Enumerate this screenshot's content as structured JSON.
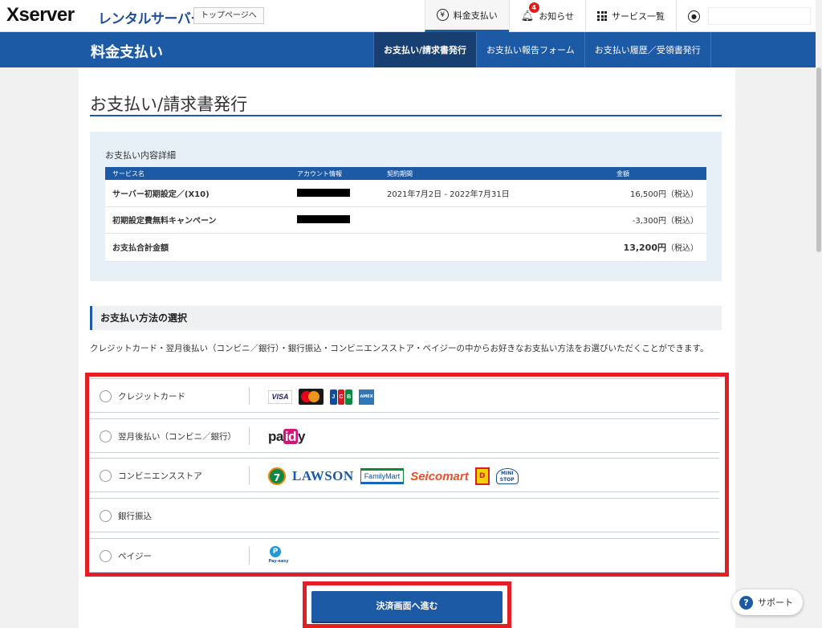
{
  "header": {
    "logo": "Xserver",
    "logo_sub": "レンタルサーバー",
    "toppage_label": "トップページへ",
    "nav": [
      {
        "label": "料金支払い",
        "icon": "yen-circle-icon"
      },
      {
        "label": "お知らせ",
        "icon": "bell-icon",
        "badge": "4"
      },
      {
        "label": "サービス一覧",
        "icon": "grid-icon"
      },
      {
        "label": "",
        "icon": "user-icon"
      }
    ]
  },
  "bluebar": {
    "title": "料金支払い",
    "tabs": [
      {
        "label": "お支払い/請求書発行",
        "active": true
      },
      {
        "label": "お支払い報告フォーム",
        "active": false
      },
      {
        "label": "お支払い履歴／受領書発行",
        "active": false
      }
    ]
  },
  "page": {
    "title": "お支払い/請求書発行"
  },
  "details": {
    "label": "お支払い内容詳細",
    "columns": [
      "サービス名",
      "アカウント情報",
      "契約期間",
      "金額"
    ],
    "rows": [
      {
        "service": "サーバー初期設定／(X10)",
        "period": "2021年7月2日 - 2022年7月31日",
        "amount": "16,500円（税込）"
      },
      {
        "service": "初期設定費無料キャンペーン",
        "period": "",
        "amount": "-3,300円（税込）"
      }
    ],
    "total_label": "お支払合計金額",
    "total_amount": "13,200円",
    "total_tax": "（税込）"
  },
  "payment": {
    "section_title": "お支払い方法の選択",
    "description": "クレジットカード・翌月後払い（コンビニ／銀行）・銀行振込・コンビニエンスストア・ペイジーの中からお好きなお支払い方法をお選びいただくことができます。",
    "options": [
      {
        "label": "クレジットカード"
      },
      {
        "label": "翌月後払い（コンビニ／銀行）"
      },
      {
        "label": "コンビニエンスストア"
      },
      {
        "label": "銀行振込"
      },
      {
        "label": "ペイジー"
      }
    ],
    "logos": {
      "visa": "VISA",
      "jcb": [
        "J",
        "C",
        "B"
      ],
      "amex": "AMEX",
      "paidy_pa": "pa",
      "paidy_id": "id",
      "paidy_y": "y",
      "seven": "7",
      "lawson": "LAWSON",
      "famima": "FamilyMart",
      "seico": "Seicomart",
      "daily": "D",
      "ministop": "MINI STOP",
      "payeasy_p": "P",
      "payeasy_t": "Pay-easy"
    },
    "proceed_label": "決済画面へ進む"
  },
  "support": {
    "label": "サポート",
    "icon": "?"
  }
}
